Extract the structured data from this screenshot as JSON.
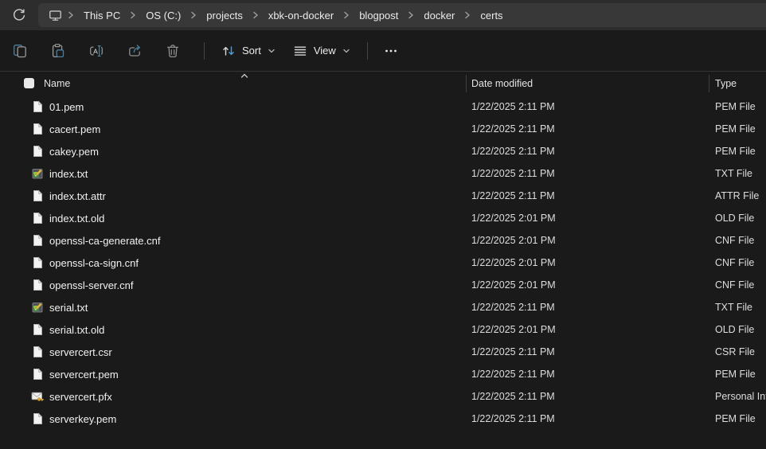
{
  "window": {
    "background": "#1a1a1a",
    "topbar_background": "#2d2d2d",
    "address_background": "#383838"
  },
  "breadcrumb": {
    "device_icon": "monitor-icon",
    "items": [
      "This PC",
      "OS (C:)",
      "projects",
      "xbk-on-docker",
      "blogpost",
      "docker",
      "certs"
    ]
  },
  "toolbar": {
    "icons": [
      "copy-icon",
      "paste-icon",
      "rename-icon",
      "share-icon",
      "delete-icon"
    ],
    "sort_label": "Sort",
    "view_label": "View",
    "more_icon": "more-options-icon",
    "accent_blue": "#4d7f9e",
    "sort_arrow_blue": "#4da0dc"
  },
  "list_header": {
    "name": "Name",
    "date_modified": "Date modified",
    "type": "Type",
    "sort_column": "Name",
    "sort_direction": "ascending"
  },
  "files": [
    {
      "name": "01.pem",
      "date_modified": "1/22/2025 2:11 PM",
      "type": "PEM File",
      "icon": "plain"
    },
    {
      "name": "cacert.pem",
      "date_modified": "1/22/2025 2:11 PM",
      "type": "PEM File",
      "icon": "plain"
    },
    {
      "name": "cakey.pem",
      "date_modified": "1/22/2025 2:11 PM",
      "type": "PEM File",
      "icon": "plain"
    },
    {
      "name": "index.txt",
      "date_modified": "1/22/2025 2:11 PM",
      "type": "TXT File",
      "icon": "txt"
    },
    {
      "name": "index.txt.attr",
      "date_modified": "1/22/2025 2:11 PM",
      "type": "ATTR File",
      "icon": "plain"
    },
    {
      "name": "index.txt.old",
      "date_modified": "1/22/2025 2:01 PM",
      "type": "OLD File",
      "icon": "plain"
    },
    {
      "name": "openssl-ca-generate.cnf",
      "date_modified": "1/22/2025 2:01 PM",
      "type": "CNF File",
      "icon": "plain"
    },
    {
      "name": "openssl-ca-sign.cnf",
      "date_modified": "1/22/2025 2:01 PM",
      "type": "CNF File",
      "icon": "plain"
    },
    {
      "name": "openssl-server.cnf",
      "date_modified": "1/22/2025 2:01 PM",
      "type": "CNF File",
      "icon": "plain"
    },
    {
      "name": "serial.txt",
      "date_modified": "1/22/2025 2:11 PM",
      "type": "TXT File",
      "icon": "txt"
    },
    {
      "name": "serial.txt.old",
      "date_modified": "1/22/2025 2:01 PM",
      "type": "OLD File",
      "icon": "plain"
    },
    {
      "name": "servercert.csr",
      "date_modified": "1/22/2025 2:11 PM",
      "type": "CSR File",
      "icon": "plain"
    },
    {
      "name": "servercert.pem",
      "date_modified": "1/22/2025 2:11 PM",
      "type": "PEM File",
      "icon": "plain"
    },
    {
      "name": "servercert.pfx",
      "date_modified": "1/22/2025 2:11 PM",
      "type": "Personal Info",
      "icon": "pfx"
    },
    {
      "name": "serverkey.pem",
      "date_modified": "1/22/2025 2:11 PM",
      "type": "PEM File",
      "icon": "plain"
    }
  ]
}
